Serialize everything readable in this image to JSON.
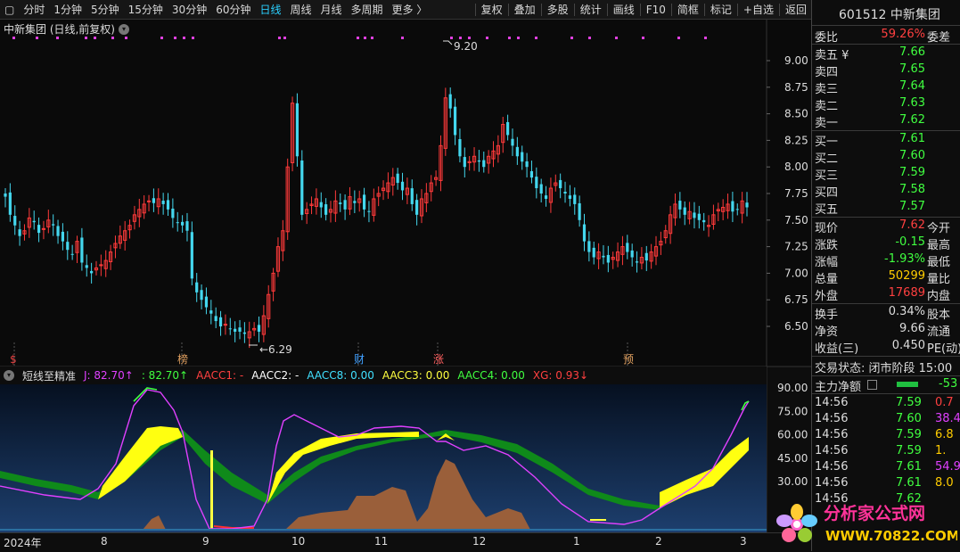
{
  "toolbar": {
    "left": [
      "分时",
      "1分钟",
      "5分钟",
      "15分钟",
      "30分钟",
      "60分钟",
      "日线",
      "周线",
      "月线",
      "多周期",
      "更多 〉"
    ],
    "active": "日线",
    "right": [
      "复权",
      "叠加",
      "多股",
      "统计",
      "画线",
      "F10",
      "简框",
      "标记",
      "+自选",
      "返回"
    ]
  },
  "main": {
    "title": "中新集团 (日线,前复权)",
    "high_label": "9.20",
    "low_label": "6.29",
    "price_ticks": [
      "9.00",
      "8.75",
      "8.50",
      "8.25",
      "8.00",
      "7.75",
      "7.50",
      "7.25",
      "7.00",
      "6.75",
      "6.50"
    ],
    "events": [
      {
        "t": "$",
        "color": "#e04040"
      },
      {
        "t": "榜",
        "color": "#e0a060"
      },
      {
        "t": "财",
        "color": "#40a0ff"
      },
      {
        "t": "涨",
        "color": "#ff6060"
      },
      {
        "t": "预",
        "color": "#e0a060"
      }
    ]
  },
  "indicator": {
    "name": "短线至精准",
    "items": [
      {
        "label": "J: 82.70↑",
        "color": "#e040ff"
      },
      {
        "label": ": 82.70↑",
        "color": "#40ff40"
      },
      {
        "label": "AACC1: -",
        "color": "#ff4040"
      },
      {
        "label": "AACC2: -",
        "color": "#ffffff"
      },
      {
        "label": "AACC8: 0.00",
        "color": "#40e0ff"
      },
      {
        "label": "AACC3: 0.00",
        "color": "#ffff40"
      },
      {
        "label": "AACC4: 0.00",
        "color": "#40ff40"
      },
      {
        "label": "XG: 0.93↓",
        "color": "#ff4040"
      }
    ],
    "ticks": [
      "90.00",
      "75.00",
      "60.00",
      "45.00",
      "30.00"
    ]
  },
  "xaxis": [
    "2024年",
    "8",
    "9",
    "10",
    "11",
    "12",
    "1",
    "2",
    "3"
  ],
  "quote": {
    "code_name": "601512 中新集团",
    "webi_label": "委比",
    "webi_val": "59.26%",
    "webi_label2": "委差",
    "sell": [
      {
        "l": "卖五 ¥",
        "v": "7.66"
      },
      {
        "l": "卖四",
        "v": "7.65"
      },
      {
        "l": "卖三",
        "v": "7.64"
      },
      {
        "l": "卖二",
        "v": "7.63"
      },
      {
        "l": "卖一",
        "v": "7.62"
      }
    ],
    "buy": [
      {
        "l": "买一",
        "v": "7.61"
      },
      {
        "l": "买二",
        "v": "7.60"
      },
      {
        "l": "买三",
        "v": "7.59"
      },
      {
        "l": "买四",
        "v": "7.58"
      },
      {
        "l": "买五",
        "v": "7.57"
      }
    ],
    "stats": [
      {
        "l": "现价",
        "v": "7.62",
        "c": "#ff4040",
        "l2": "今开"
      },
      {
        "l": "涨跌",
        "v": "-0.15",
        "c": "#40ff40",
        "l2": "最高"
      },
      {
        "l": "涨幅",
        "v": "-1.93%",
        "c": "#40ff40",
        "l2": "最低"
      },
      {
        "l": "总量",
        "v": "50299",
        "c": "#ffcc00",
        "l2": "量比"
      },
      {
        "l": "外盘",
        "v": "17689",
        "c": "#ff4040",
        "l2": "内盘"
      }
    ],
    "stats2": [
      {
        "l": "换手",
        "v": "0.34%",
        "l2": "股本"
      },
      {
        "l": "净资",
        "v": "9.66",
        "l2": "流通"
      },
      {
        "l": "收益(三)",
        "v": "0.450",
        "l2": "PE(动)"
      }
    ],
    "trade_status": "交易状态: 闭市阶段 15:00",
    "main_net": "主力净额",
    "main_net_val": "-53",
    "ticks": [
      {
        "t": "14:56",
        "p": "7.59",
        "v": "0.7",
        "c": "#ff4040"
      },
      {
        "t": "14:56",
        "p": "7.60",
        "v": "38.4",
        "c": "#e040ff"
      },
      {
        "t": "14:56",
        "p": "7.59",
        "v": "6.8",
        "c": "#ffcc00"
      },
      {
        "t": "14:56",
        "p": "7.59",
        "v": "1.",
        "c": "#ffcc00"
      },
      {
        "t": "14:56",
        "p": "7.61",
        "v": "54.9",
        "c": "#e040ff"
      },
      {
        "t": "14:56",
        "p": "7.61",
        "v": "8.0",
        "c": "#ffcc00"
      },
      {
        "t": "14:56",
        "p": "7.62",
        "v": "",
        "c": "#40ff40"
      }
    ]
  },
  "watermark": {
    "line1": "分析家公式网",
    "line2": "WWW.70822.COM"
  }
}
